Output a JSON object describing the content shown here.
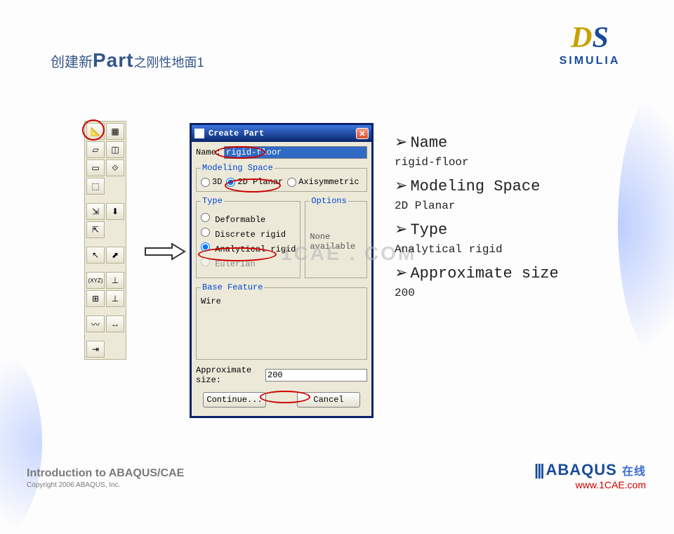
{
  "title": {
    "pre": "创建新",
    "big": "Part",
    "post": "之刚性地面1"
  },
  "logo": {
    "ds": "DS",
    "simulia": "SIMULIA"
  },
  "dialog": {
    "title": "Create Part",
    "name_label": "Name:",
    "name_value": "rigid-floor",
    "modeling_space": {
      "legend": "Modeling Space",
      "opt_3d": "3D",
      "opt_planar": "2D Planar",
      "opt_axi": "Axisymmetric"
    },
    "type": {
      "legend": "Type",
      "opt_deform": "Deformable",
      "opt_discrete": "Discrete rigid",
      "opt_analytical": "Analytical rigid",
      "opt_eulerian": "Eulerian"
    },
    "options": {
      "legend": "Options",
      "text": "None available"
    },
    "base_feature": {
      "legend": "Base Feature",
      "text": "Wire"
    },
    "approx_label": "Approximate size:",
    "approx_value": "200",
    "btn_continue": "Continue...",
    "btn_cancel": "Cancel"
  },
  "bullets": {
    "h1": "Name",
    "v1": "rigid-floor",
    "h2": "Modeling Space",
    "v2": "2D Planar",
    "h3": "Type",
    "v3": "Analytical rigid",
    "h4": "Approximate size",
    "v4": "200"
  },
  "watermark": "1CAE . COM",
  "footer": {
    "line1": "Introduction to ABAQUS/CAE",
    "line2": "Copyright 2006 ABAQUS, Inc.",
    "brand": "ABAQUS",
    "brand_cn": "在线",
    "url": "www.1CAE.com"
  },
  "toolbar_icons": [
    "📐",
    "▦",
    "▱",
    "◫",
    "▭",
    "⟐",
    "⬚",
    "",
    "⇲",
    "⬇",
    "⇱",
    "",
    "↖",
    "⬈",
    "(XYZ)",
    "⊥",
    "⊞",
    "⊥",
    "〰",
    "↔",
    "⇥",
    ""
  ]
}
